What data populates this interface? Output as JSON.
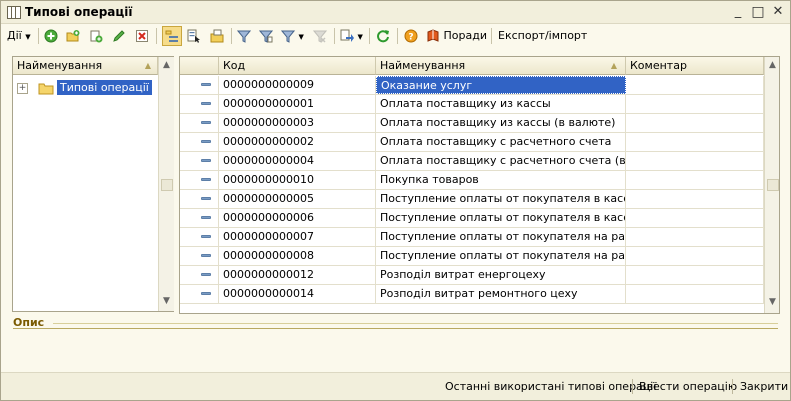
{
  "window": {
    "title": "Типові операції",
    "controls": {
      "minimize": "_",
      "maximize": "□",
      "close": "✕"
    }
  },
  "toolbar": {
    "actions_label": "Дії",
    "help_label": "Поради",
    "export_label": "Експорт/імпорт"
  },
  "left_panel": {
    "header": "Найменування",
    "tree": [
      {
        "label": "Типові операції",
        "expand": "+"
      }
    ]
  },
  "table": {
    "columns": {
      "code": "Код",
      "name": "Найменування",
      "comment": "Коментар"
    },
    "rows": [
      {
        "code": "0000000000009",
        "name": "Оказание услуг",
        "comment": ""
      },
      {
        "code": "0000000000001",
        "name": "Оплата поставщику из кассы",
        "comment": ""
      },
      {
        "code": "0000000000003",
        "name": "Оплата поставщику из кассы (в валюте)",
        "comment": ""
      },
      {
        "code": "0000000000002",
        "name": "Оплата поставщику с расчетного счета",
        "comment": ""
      },
      {
        "code": "0000000000004",
        "name": "Оплата поставщику с расчетного счета (в ва...",
        "comment": ""
      },
      {
        "code": "0000000000010",
        "name": "Покупка товаров",
        "comment": ""
      },
      {
        "code": "0000000000005",
        "name": "Поступление оплаты от покупателя в кассу",
        "comment": ""
      },
      {
        "code": "0000000000006",
        "name": "Поступление оплаты от покупателя в кассу (...",
        "comment": ""
      },
      {
        "code": "0000000000007",
        "name": "Поступление оплаты от покупателя на расче...",
        "comment": ""
      },
      {
        "code": "0000000000008",
        "name": "Поступление оплаты от покупателя на расче...",
        "comment": ""
      },
      {
        "code": "0000000000012",
        "name": "Розподіл витрат енергоцеху",
        "comment": ""
      },
      {
        "code": "0000000000014",
        "name": "Розподіл витрат ремонтного цеху",
        "comment": ""
      }
    ]
  },
  "description": {
    "label": "Опис"
  },
  "statusbar": {
    "recent_label": "Останні використані типові операції",
    "enter_label": "Ввести операцію",
    "close_label": "Закрити"
  },
  "colors": {
    "selection": "#3163c5",
    "accent_label": "#7a5a00"
  }
}
